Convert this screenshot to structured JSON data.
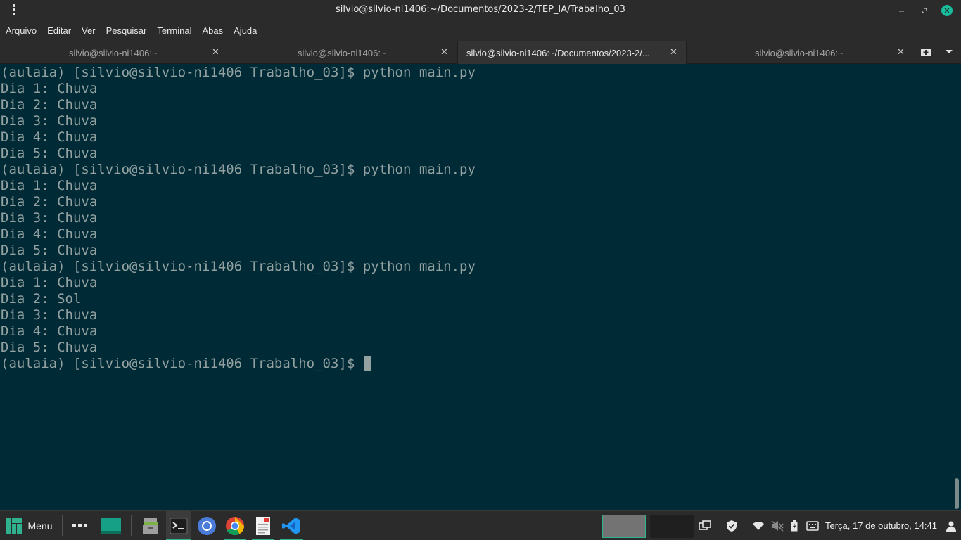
{
  "window": {
    "title": "silvio@silvio-ni1406:~/Documentos/2023-2/TEP_IA/Trabalho_03"
  },
  "menubar": {
    "items": [
      "Arquivo",
      "Editar",
      "Ver",
      "Pesquisar",
      "Terminal",
      "Abas",
      "Ajuda"
    ]
  },
  "tabs": [
    {
      "label": "silvio@silvio-ni1406:~",
      "close": "✕",
      "active": false
    },
    {
      "label": "silvio@silvio-ni1406:~",
      "close": "✕",
      "active": false
    },
    {
      "label": "silvio@silvio-ni1406:~/Documentos/2023-2/...",
      "close": "✕",
      "active": true
    },
    {
      "label": "silvio@silvio-ni1406:~",
      "close": "✕",
      "active": false
    }
  ],
  "terminal": {
    "lines": [
      "(aulaia) [silvio@silvio-ni1406 Trabalho_03]$ python main.py",
      "Dia 1: Chuva",
      "Dia 2: Chuva",
      "Dia 3: Chuva",
      "Dia 4: Chuva",
      "Dia 5: Chuva",
      "(aulaia) [silvio@silvio-ni1406 Trabalho_03]$ python main.py",
      "Dia 1: Chuva",
      "Dia 2: Chuva",
      "Dia 3: Chuva",
      "Dia 4: Chuva",
      "Dia 5: Chuva",
      "(aulaia) [silvio@silvio-ni1406 Trabalho_03]$ python main.py",
      "Dia 1: Chuva",
      "Dia 2: Sol",
      "Dia 3: Chuva",
      "Dia 4: Chuva",
      "Dia 5: Chuva"
    ],
    "prompt": "(aulaia) [silvio@silvio-ni1406 Trabalho_03]$ "
  },
  "taskbar": {
    "menu_label": "Menu",
    "clock": "Terça, 17 de outubro, 14:41",
    "accent": "#2fb38e"
  },
  "colors": {
    "terminal_bg": "#002b36",
    "terminal_fg": "#93a1a1",
    "chrome_bg": "#2b2b2b"
  }
}
